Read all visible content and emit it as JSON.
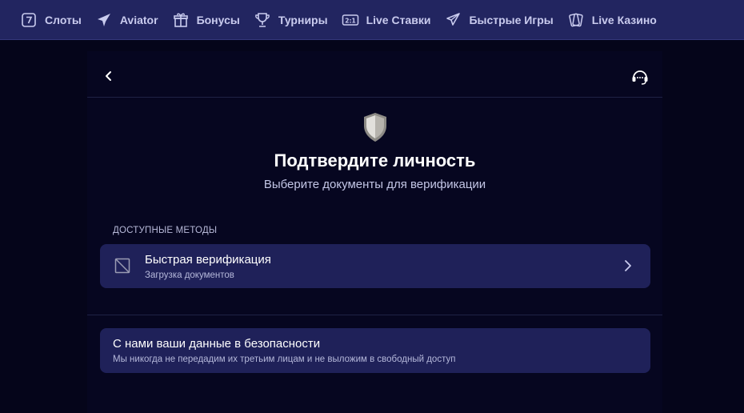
{
  "nav": {
    "items": [
      {
        "label": "Слоты",
        "icon": "slot-seven-icon"
      },
      {
        "label": "Aviator",
        "icon": "plane-icon"
      },
      {
        "label": "Бонусы",
        "icon": "gift-icon"
      },
      {
        "label": "Турниры",
        "icon": "trophy-icon"
      },
      {
        "label": "Live Ставки",
        "icon": "scoreboard-icon"
      },
      {
        "label": "Быстрые Игры",
        "icon": "rocket-icon"
      },
      {
        "label": "Live Казино",
        "icon": "cards-icon"
      }
    ]
  },
  "header": {
    "back_icon": "chevron-left-icon",
    "support_icon": "headset-icon"
  },
  "verify": {
    "title": "Подтвердите личность",
    "subtitle": "Выберите документы для верификации",
    "section_label": "ДОСТУПНЫЕ МЕТОДЫ",
    "method": {
      "title": "Быстрая верификация",
      "subtitle": "Загрузка документов"
    },
    "info": {
      "title": "С нами ваши данные в безопасности",
      "subtitle": "Мы никогда не передадим их третьим лицам и не выложим в свободный доступ"
    }
  },
  "colors": {
    "nav_bg": "#222560",
    "page_bg": "#05051a",
    "card_bg": "#1f2159",
    "text_muted": "#c3c6e6"
  }
}
